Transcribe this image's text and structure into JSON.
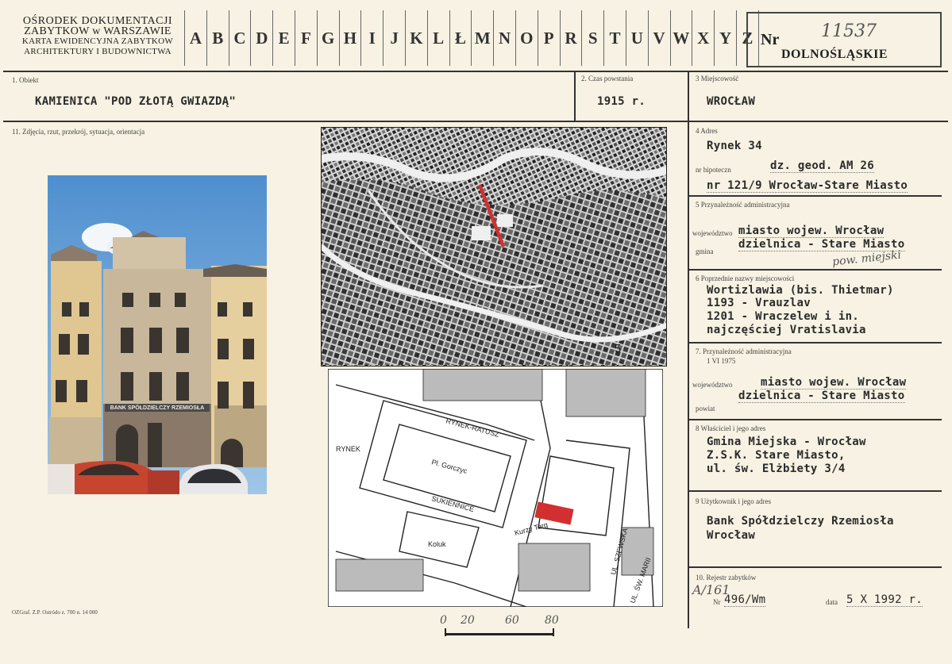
{
  "header": {
    "institution_lines": [
      "OŚRODEK DOKUMENTACJI",
      "ZABYTKOW w WARSZAWIE",
      "KARTA EWIDENCYJNA ZABYTKOW",
      "ARCHITEKTURY I BUDOWNICTWA"
    ],
    "letters": [
      "A",
      "B",
      "C",
      "D",
      "E",
      "F",
      "G",
      "H",
      "I",
      "J",
      "K",
      "L",
      "Ł",
      "M",
      "N",
      "O",
      "P",
      "R",
      "S",
      "T",
      "U",
      "V",
      "W",
      "X",
      "Y",
      "Z"
    ],
    "nr_label": "Nr",
    "nr_handwritten": "11537",
    "region": "DOLNOŚLĄSKIE"
  },
  "row1": {
    "obiekt_label": "1. Obiekt",
    "obiekt_value": "KAMIENICA \"POD ZŁOTĄ GWIAZDĄ\"",
    "czas_label": "2. Czas powstania",
    "czas_value": "1915 r.",
    "miejscowosc_label": "3 Miejscowość",
    "miejscowosc_value": "WROCŁAW"
  },
  "photos_label": "11. Zdjęcia, rzut, przekrój, sytuacja, orientacja",
  "photo": {
    "sign_text": "BANK SPÓŁDZIELCZY RZEMIOSŁA"
  },
  "map_large": {
    "number": "5"
  },
  "map_small": {
    "labels": [
      "RYNEK",
      "RYNEK-RATUSZ",
      "Pl. Gorczyc",
      "SUKIENNICE",
      "Kurzy Targ",
      "UL. SZEWSKA",
      "UL. ŚW. MARII",
      "Koluk"
    ]
  },
  "scale": {
    "ticks": [
      "0",
      "20",
      "60",
      "80"
    ]
  },
  "footer_print": "OZGraf. Z.P. Ostródo z. 700 n. 14 000",
  "right": {
    "adres_label": "4 Adres",
    "adres_value": "Rynek 34",
    "hipoteczny_label": "nr hipoteczn",
    "hipoteczny_value": "dz. geod. AM 26",
    "hipoteczny_value2": "nr 121/9 Wrocław-Stare Miasto",
    "przyn_label": "5 Przynależność administracyjna",
    "woj_label": "województwo",
    "woj_value": "miasto wojew. Wrocław",
    "gmina_label": "gmina",
    "gmina_value": "dzielnica - Stare Miasto",
    "hand_note": "pow. miejski",
    "poprzednie_label": "6 Poprzednie nazwy miejscowości",
    "poprzednie_lines": [
      "Wortizlawia (bis. Thietmar)",
      "1193 - Vrauzlav",
      "1201 - Wraczelew i in.",
      "najczęściej Vratislavia"
    ],
    "przyn2_label": "7. Przynależność administracyjna",
    "przyn2_date": "1 VI 1975",
    "woj2_label": "województwo",
    "woj2_value": "miasto wojew. Wrocław",
    "powiat_label": "powiat",
    "powiat_value": "dzielnica - Stare Miasto",
    "wlasciciel_label": "8 Właściciel i jego adres",
    "wlasciciel_lines": [
      "Gmina Miejska - Wrocław",
      "Z.S.K. Stare Miasto,",
      "ul. św. Elżbiety 3/4"
    ],
    "uzytkownik_label": "9 Użytkownik i jego adres",
    "uzytkownik_lines": [
      "Bank Spółdzielczy Rzemiosła",
      "Wrocław"
    ],
    "rejestr_label": "10. Rejestr zabytków",
    "rejestr_hand": "A/161",
    "rejestr_nr_label": "Nr",
    "rejestr_nr_value": "496/Wm",
    "data_label": "data",
    "data_value": "5 X 1992 r."
  }
}
